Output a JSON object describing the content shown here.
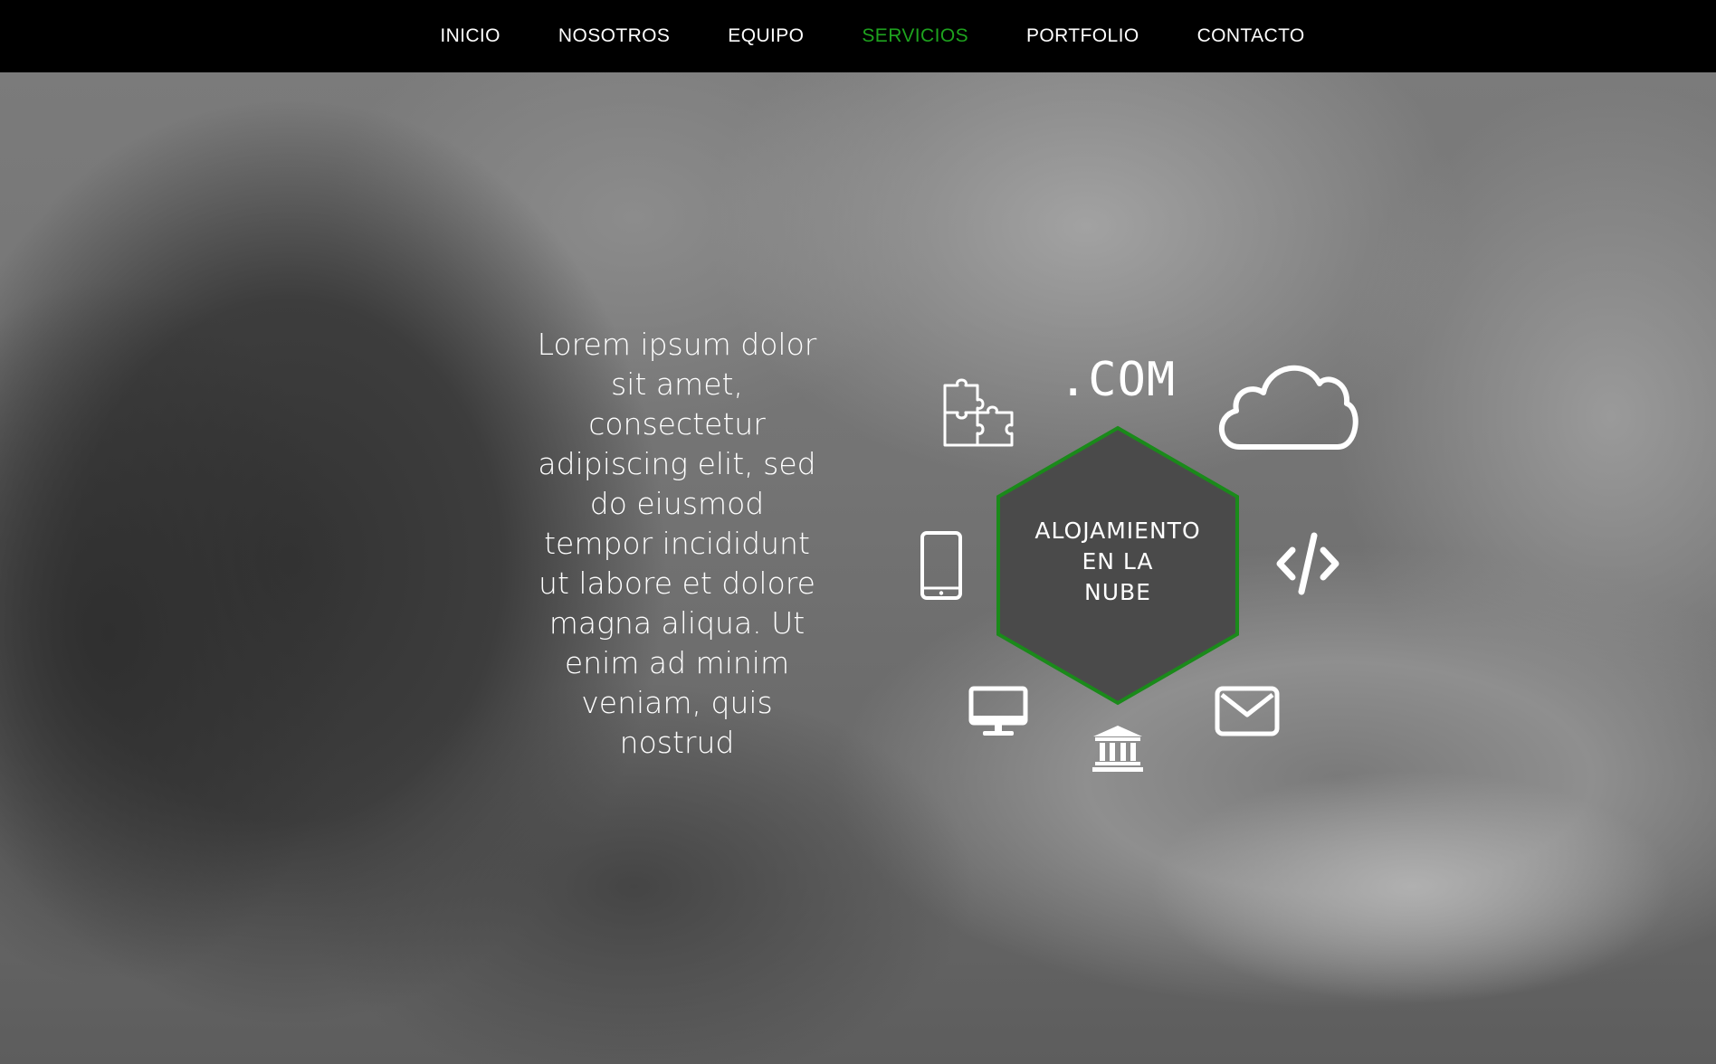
{
  "nav": {
    "items": [
      {
        "label": "INICIO"
      },
      {
        "label": "NOSOTROS"
      },
      {
        "label": "EQUIPO"
      },
      {
        "label": "SERVICIOS"
      },
      {
        "label": "PORTFOLIO"
      },
      {
        "label": "CONTACTO"
      }
    ],
    "active": "SERVICIOS"
  },
  "hero": {
    "paragraph": "Lorem ipsum dolor sit amet, consectetur adipiscing elit, sed do eiusmod tempor incididunt ut labore et dolore magna aliqua. Ut enim ad minim veniam, quis nostrud"
  },
  "services": {
    "center_lines": [
      "ALOJAMIENTO",
      "EN LA",
      "NUBE"
    ],
    "domain_text": ".COM",
    "icons": [
      "puzzle-icon",
      "cloud-icon",
      "mobile-phone-icon",
      "code-icon",
      "desktop-monitor-icon",
      "bank-icon",
      "envelope-icon"
    ]
  },
  "colors": {
    "nav_background": "#000000",
    "nav_text": "#ffffff",
    "active_accent": "#1ea31e",
    "hexagon_fill": "#4a4a4a",
    "hexagon_border": "#1a8a1a"
  }
}
